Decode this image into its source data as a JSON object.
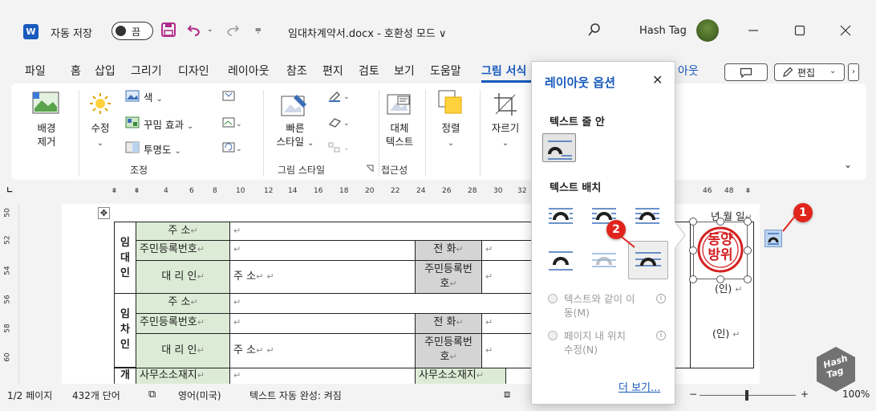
{
  "titlebar": {
    "app_icon": "W",
    "autosave_label": "자동 저장",
    "autosave_state": "끔",
    "doc_title": "임대차계약서.docx  -  호환성 모드 ∨",
    "user_name": "Hash Tag"
  },
  "tabs": [
    "파일",
    "홈",
    "삽입",
    "그리기",
    "디자인",
    "레이아웃",
    "참조",
    "편지",
    "검토",
    "보기",
    "도움말",
    "그림 서식"
  ],
  "tab_behind": "아웃",
  "edit_button": "편집",
  "ribbon": {
    "remove_bg": [
      "배경",
      "제거"
    ],
    "corrections": "수정",
    "color": "색",
    "artistic": "꾸밈 효과",
    "transparency": "투명도",
    "adjust_group": "조정",
    "quick_styles": [
      "빠른",
      "스타일"
    ],
    "styles_group": "그림 스타일",
    "alt_text": [
      "대체",
      "텍스트"
    ],
    "accessibility_group": "접근성",
    "arrange": "정렬",
    "crop": "자르기"
  },
  "ruler": {
    "ticks": [
      "4",
      "6",
      "8",
      "10",
      "12",
      "14",
      "16",
      "18",
      "20",
      "22",
      "24",
      "26",
      "28",
      "30",
      "32"
    ],
    "right_ticks": [
      "46",
      "48"
    ]
  },
  "vruler": [
    "50",
    "52",
    "54",
    "56",
    "58",
    "60"
  ],
  "table": {
    "landlord_label": [
      "임",
      "대",
      "인"
    ],
    "tenant_label": [
      "임",
      "차",
      "인"
    ],
    "address": "주          소",
    "resident_no": "주민등록번호",
    "agent": "대  리  인",
    "address_short": "주 소",
    "phone": "전      화",
    "resident_no_wrap": [
      "주민등록번",
      "호"
    ],
    "biz_addr": "사무소소재지",
    "biz_label": "개",
    "date_text": "년   월   일",
    "seal_text": "(인)",
    "seal_text2": "(인)",
    "stamp_text": [
      "동양",
      "방위"
    ]
  },
  "pane": {
    "title": "레이아웃 옵션",
    "inline_section": "텍스트 줄 안",
    "wrap_section": "텍스트 배치",
    "move_with_text": [
      "텍스트와 같이 이",
      "동(M)"
    ],
    "fix_on_page": [
      "페이지 내 위치",
      "수정(N)"
    ],
    "see_more": "더 보기..."
  },
  "badges": [
    "1",
    "2"
  ],
  "status": {
    "page": "1/2 페이지",
    "words": "432개 단어",
    "language": "영어(미국)",
    "autocomplete": "텍스트 자동 완성: 켜짐",
    "zoom": "100%"
  },
  "watermark": [
    "Hash",
    "Tag"
  ],
  "colors": {
    "accent": "#185abd",
    "badge": "#e0241c",
    "stamp": "#d42020",
    "cell_green": "#dcebd5"
  }
}
